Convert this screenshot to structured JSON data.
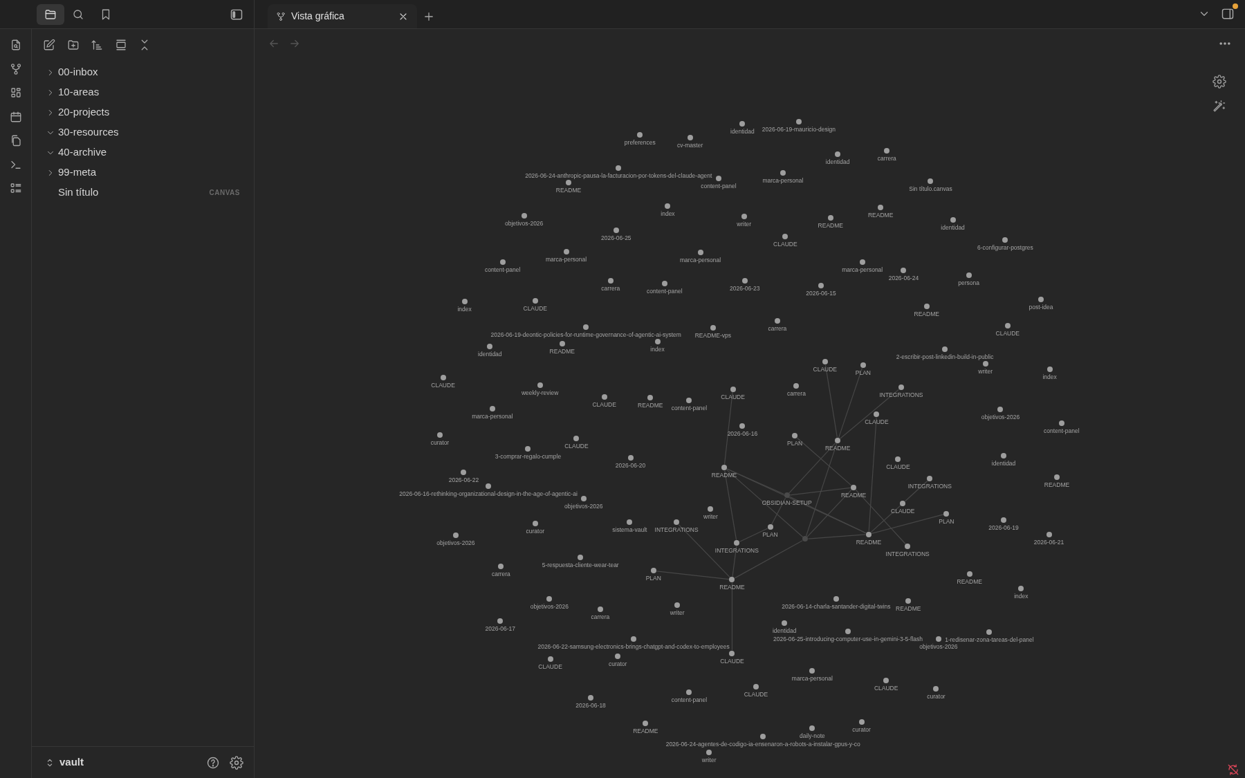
{
  "sidebar": {
    "tabs": [
      {
        "kind": "files",
        "selected": true
      },
      {
        "kind": "search",
        "selected": false
      },
      {
        "kind": "bookmarks",
        "selected": false
      }
    ],
    "tree": [
      {
        "label": "00-inbox",
        "kind": "folder",
        "expanded": false
      },
      {
        "label": "10-areas",
        "kind": "folder",
        "expanded": false
      },
      {
        "label": "20-projects",
        "kind": "folder",
        "expanded": false
      },
      {
        "label": "30-resources",
        "kind": "folder",
        "expanded": true
      },
      {
        "label": "40-archive",
        "kind": "folder",
        "expanded": true
      },
      {
        "label": "99-meta",
        "kind": "folder",
        "expanded": false
      },
      {
        "label": "Sin título",
        "kind": "file",
        "badge": "CANVAS"
      }
    ],
    "vault": "vault"
  },
  "tabs": [
    {
      "label": "Vista gráfica",
      "selected": true
    }
  ],
  "update_available": true,
  "graph": {
    "nodes": [
      {
        "label": "identidad",
        "kind": "note"
      },
      {
        "label": "2026-06-19-mauricio-design",
        "kind": "note"
      },
      {
        "label": "preferences",
        "kind": "note"
      },
      {
        "label": "cv-master",
        "kind": "note"
      },
      {
        "label": "identidad",
        "kind": "note"
      },
      {
        "label": "carrera",
        "kind": "note"
      },
      {
        "label": "2026-06-24-anthropic-pausa-la-facturacion-por-tokens-del-claude-agent",
        "kind": "note"
      },
      {
        "label": "marca-personal",
        "kind": "note"
      },
      {
        "label": "README",
        "kind": "note"
      },
      {
        "label": "content-panel",
        "kind": "note"
      },
      {
        "label": "Sin título.canvas",
        "kind": "note"
      },
      {
        "label": "index",
        "kind": "note"
      },
      {
        "label": "README",
        "kind": "note"
      },
      {
        "label": "objetivos-2026",
        "kind": "note"
      },
      {
        "label": "writer",
        "kind": "note"
      },
      {
        "label": "README",
        "kind": "note"
      },
      {
        "label": "identidad",
        "kind": "note"
      },
      {
        "label": "2026-06-25",
        "kind": "note"
      },
      {
        "label": "CLAUDE",
        "kind": "note"
      },
      {
        "label": "6-configurar-postgres",
        "kind": "note"
      },
      {
        "label": "marca-personal",
        "kind": "note"
      },
      {
        "label": "marca-personal",
        "kind": "note"
      },
      {
        "label": "content-panel",
        "kind": "note"
      },
      {
        "label": "marca-personal",
        "kind": "note"
      },
      {
        "label": "2026-06-24",
        "kind": "note"
      },
      {
        "label": "persona",
        "kind": "note"
      },
      {
        "label": "carrera",
        "kind": "note"
      },
      {
        "label": "content-panel",
        "kind": "note"
      },
      {
        "label": "2026-06-23",
        "kind": "note"
      },
      {
        "label": "2026-06-15",
        "kind": "note"
      },
      {
        "label": "index",
        "kind": "note"
      },
      {
        "label": "CLAUDE",
        "kind": "note"
      },
      {
        "label": "README",
        "kind": "note"
      },
      {
        "label": "post-idea",
        "kind": "note"
      },
      {
        "label": "2026-06-19-deontic-policies-for-runtime-governance-of-agentic-ai-system",
        "kind": "note"
      },
      {
        "label": "README-vps",
        "kind": "note"
      },
      {
        "label": "carrera",
        "kind": "note"
      },
      {
        "label": "CLAUDE",
        "kind": "note"
      },
      {
        "label": "identidad",
        "kind": "note"
      },
      {
        "label": "README",
        "kind": "note"
      },
      {
        "label": "index",
        "kind": "note"
      },
      {
        "label": "CLAUDE",
        "kind": "note"
      },
      {
        "label": "PLAN",
        "kind": "note"
      },
      {
        "label": "2-escribir-post-linkedin-build-in-public",
        "kind": "note"
      },
      {
        "label": "writer",
        "kind": "note"
      },
      {
        "label": "index",
        "kind": "note"
      },
      {
        "label": "CLAUDE",
        "kind": "note"
      },
      {
        "label": "weekly-review",
        "kind": "note"
      },
      {
        "label": "CLAUDE",
        "kind": "note"
      },
      {
        "label": "carrera",
        "kind": "note"
      },
      {
        "label": "INTEGRATIONS",
        "kind": "note"
      },
      {
        "label": "CLAUDE",
        "kind": "note"
      },
      {
        "label": "README",
        "kind": "note"
      },
      {
        "label": "content-panel",
        "kind": "note"
      },
      {
        "label": "marca-personal",
        "kind": "note"
      },
      {
        "label": "CLAUDE",
        "kind": "note"
      },
      {
        "label": "objetivos-2026",
        "kind": "note"
      },
      {
        "label": "2026-06-16",
        "kind": "note"
      },
      {
        "label": "content-panel",
        "kind": "note"
      },
      {
        "label": "curator",
        "kind": "note"
      },
      {
        "label": "CLAUDE",
        "kind": "note"
      },
      {
        "label": "PLAN",
        "kind": "note"
      },
      {
        "label": "README",
        "kind": "note"
      },
      {
        "label": "3-comprar-regalo-cumple",
        "kind": "note"
      },
      {
        "label": "2026-06-20",
        "kind": "note"
      },
      {
        "label": "CLAUDE",
        "kind": "note"
      },
      {
        "label": "identidad",
        "kind": "note"
      },
      {
        "label": "2026-06-22",
        "kind": "note"
      },
      {
        "label": "README",
        "kind": "note"
      },
      {
        "label": "INTEGRATIONS",
        "kind": "note"
      },
      {
        "label": "README",
        "kind": "note"
      },
      {
        "label": "2026-06-16-rethinking-organizational-design-in-the-age-of-agentic-ai",
        "kind": "note"
      },
      {
        "label": "README",
        "kind": "note"
      },
      {
        "label": "objetivos-2026",
        "kind": "note"
      },
      {
        "label": "OBSIDIAN-SETUP",
        "kind": "unresolved"
      },
      {
        "label": "CLAUDE",
        "kind": "note"
      },
      {
        "label": "writer",
        "kind": "note"
      },
      {
        "label": "PLAN",
        "kind": "note"
      },
      {
        "label": "curator",
        "kind": "note"
      },
      {
        "label": "sistema-vault",
        "kind": "note"
      },
      {
        "label": "INTEGRATIONS",
        "kind": "note"
      },
      {
        "label": "PLAN",
        "kind": "note"
      },
      {
        "label": "2026-06-19",
        "kind": "note"
      },
      {
        "label": "objetivos-2026",
        "kind": "note"
      },
      {
        "kind": "unresolved"
      },
      {
        "label": "README",
        "kind": "note"
      },
      {
        "label": "2026-06-21",
        "kind": "note"
      },
      {
        "label": "INTEGRATIONS",
        "kind": "note"
      },
      {
        "label": "INTEGRATIONS",
        "kind": "note"
      },
      {
        "label": "5-respuesta-cliente-wear-tear",
        "kind": "note"
      },
      {
        "label": "carrera",
        "kind": "note"
      },
      {
        "label": "PLAN",
        "kind": "note"
      },
      {
        "label": "README",
        "kind": "note"
      },
      {
        "label": "README",
        "kind": "note"
      },
      {
        "label": "index",
        "kind": "note"
      },
      {
        "label": "objetivos-2026",
        "kind": "note"
      },
      {
        "label": "2026-06-14-charla-santander-digital-twins",
        "kind": "note"
      },
      {
        "label": "README",
        "kind": "note"
      },
      {
        "label": "carrera",
        "kind": "note"
      },
      {
        "label": "writer",
        "kind": "note"
      },
      {
        "label": "2026-06-17",
        "kind": "note"
      },
      {
        "label": "identidad",
        "kind": "note"
      },
      {
        "label": "2026-06-22-samsung-electronics-brings-chatgpt-and-codex-to-employees",
        "kind": "note"
      },
      {
        "label": "2026-06-25-introducing-computer-use-in-gemini-3-5-flash",
        "kind": "note"
      },
      {
        "label": "objetivos-2026",
        "kind": "note"
      },
      {
        "label": "1-redisenar-zona-tareas-del-panel",
        "kind": "note"
      },
      {
        "label": "CLAUDE",
        "kind": "note"
      },
      {
        "label": "curator",
        "kind": "note"
      },
      {
        "label": "CLAUDE",
        "kind": "note"
      },
      {
        "label": "marca-personal",
        "kind": "note"
      },
      {
        "label": "content-panel",
        "kind": "note"
      },
      {
        "label": "CLAUDE",
        "kind": "note"
      },
      {
        "label": "CLAUDE",
        "kind": "note"
      },
      {
        "label": "curator",
        "kind": "note"
      },
      {
        "label": "2026-06-18",
        "kind": "note"
      },
      {
        "label": "README",
        "kind": "note"
      },
      {
        "label": "daily-note",
        "kind": "note"
      },
      {
        "label": "curator",
        "kind": "note"
      },
      {
        "label": "2026-06-24-agentes-de-codigo-ia-ensenaron-a-robots-a-instalar-gpus-y-co",
        "kind": "note"
      },
      {
        "label": "writer",
        "kind": "note"
      }
    ]
  }
}
